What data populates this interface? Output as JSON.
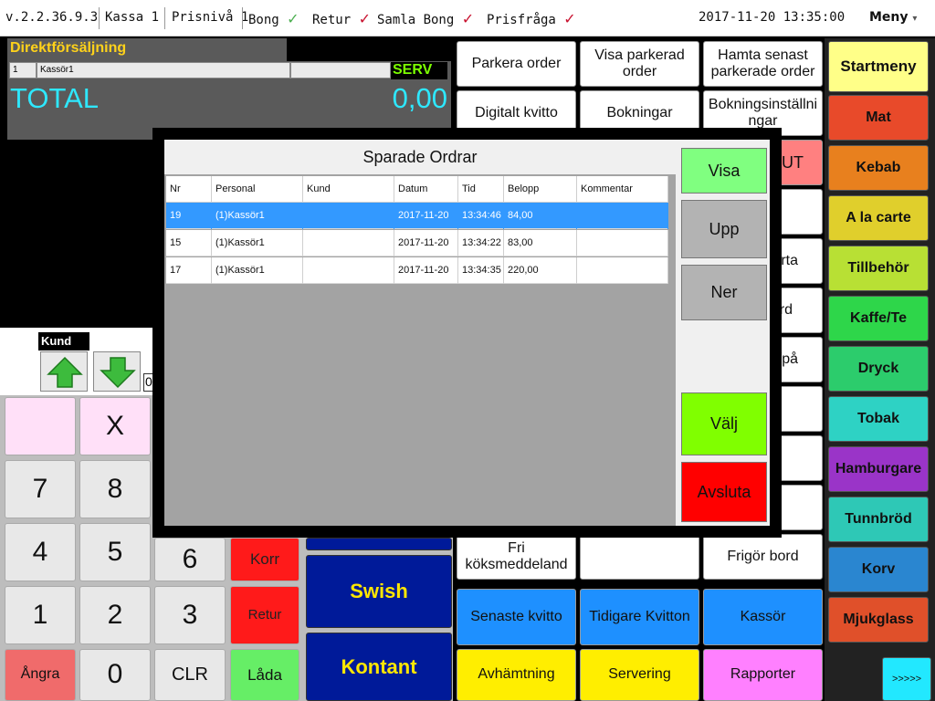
{
  "topbar": {
    "version": "v.2.2.36.9.3",
    "kassa": "Kassa 1",
    "prisniva": "Prisnivå 1",
    "bong": "Bong",
    "retur": "Retur",
    "samla_bong": "Samla Bong",
    "prisfraga": "Prisfråga",
    "datetime": "2017-11-20 13:35:00",
    "menu": "Meny",
    "check": "✓",
    "dropdown": "▾"
  },
  "order_panel": {
    "title": "Direktförsäljning",
    "row_no": "1",
    "cashier": "Kassör1",
    "serv": "SERV",
    "total_label": "TOTAL",
    "total_value": "0,00",
    "kund_label": "Kund",
    "small_field": "0"
  },
  "keypad": {
    "x": "X",
    "k7": "7",
    "k8": "8",
    "k4": "4",
    "k5": "5",
    "k6": "6",
    "k1": "1",
    "k2": "2",
    "k3": "3",
    "k0": "0",
    "angra": "Ångra",
    "clr": "CLR",
    "korr": "Korr",
    "retur": "Retur",
    "lada": "Låda"
  },
  "pay": {
    "swish": "Swish",
    "kontant": "Kontant"
  },
  "mid": {
    "parkera": "Parkera order",
    "visa_parkerad": "Visa parkerad order",
    "hamta_senast": "Hamta senast parkerade order",
    "digitalt_kvitto": "Digitalt kvitto",
    "bokningar": "Bokningar",
    "bokningsinst": "Bokningsinställni ngar",
    "ut": "UT",
    "rta": "rta",
    "rd": "rd",
    "pa": "/på",
    "fri_kok": "Fri köksmeddeland",
    "frigor": "Frigör bord",
    "senaste": "Senaste kvitto",
    "tidigare": "Tidigare Kvitton",
    "kassor": "Kassör",
    "avhamtning": "Avhämtning",
    "servering": "Servering",
    "rapporter": "Rapporter"
  },
  "menu": {
    "startmeny": "Startmeny",
    "items": [
      "Mat",
      "Kebab",
      "A la carte",
      "Tillbehör",
      "Kaffe/Te",
      "Dryck",
      "Tobak",
      "Hamburgare",
      "Tunnbröd",
      "Korv",
      "Mjukglass"
    ],
    "colors": [
      "#e84a2a",
      "#e8801e",
      "#e0cf2c",
      "#b8e034",
      "#2ed64a",
      "#2ccc6c",
      "#2ed2c4",
      "#9a34c8",
      "#2ec8b6",
      "#2a86d0",
      "#e0502a"
    ],
    "more": ">>>>>"
  },
  "modal": {
    "title": "Sparade Ordrar",
    "columns": [
      "Nr",
      "Personal",
      "Kund",
      "Datum",
      "Tid",
      "Belopp",
      "Kommentar"
    ],
    "rows": [
      [
        "19",
        "(1)Kassör1",
        "",
        "2017-11-20",
        "13:34:46",
        "84,00",
        ""
      ],
      [
        "15",
        "(1)Kassör1",
        "",
        "2017-11-20",
        "13:34:22",
        "83,00",
        ""
      ],
      [
        "17",
        "(1)Kassör1",
        "",
        "2017-11-20",
        "13:34:35",
        "220,00",
        ""
      ]
    ],
    "selected_row": 0,
    "visa": "Visa",
    "upp": "Upp",
    "ner": "Ner",
    "valj": "Välj",
    "avsluta": "Avsluta"
  }
}
